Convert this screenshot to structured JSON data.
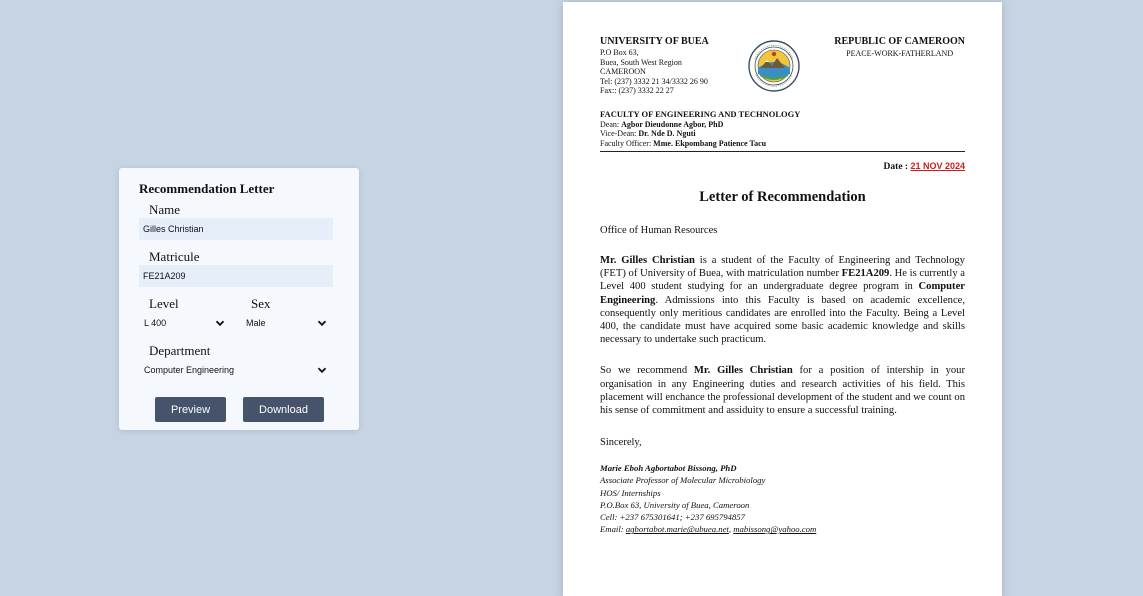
{
  "form": {
    "title": "Recommendation Letter",
    "name_label": "Name",
    "name_value": "Gilles Christian",
    "matricule_label": "Matricule",
    "matricule_value": "FE21A209",
    "level_label": "Level",
    "level_value": "L 400",
    "sex_label": "Sex",
    "sex_value": "Male",
    "department_label": "Department",
    "department_value": "Computer Engineering",
    "preview_label": "Preview",
    "download_label": "Download"
  },
  "letter": {
    "university": "UNIVERSITY OF BUEA",
    "address_lines": [
      "P.O Box 63,",
      "Buea, South West Region",
      "CAMEROON",
      "Tel: (237) 3332 21 34/3332 26 90",
      "Fax:: (237) 3332 22 27"
    ],
    "republic": "REPUBLIC OF CAMEROON",
    "motto": "PEACE-WORK-FATHERLAND",
    "faculty_title": "FACULTY OF ENGINEERING AND TECHNOLOGY",
    "dean_label": "Dean:",
    "dean_name": "Agbor Dieudonne Agbor, PhD",
    "vice_dean_label": "Vice-Dean:",
    "vice_dean_name": "Dr. Nde D. Nguti",
    "officer_label": "Faculty Officer:",
    "officer_name": "Mme. Ekpombang Patience Tacu",
    "date_label": "Date :",
    "date_value": "21 NOV 2024",
    "title": "Letter of Recommendation",
    "recipient": "Office of Human Resources",
    "p1_student": "Mr. Gilles Christian",
    "p1_text_a": " is a student of the Faculty of Engineering and Technology (FET) of University of Buea, with matriculation number ",
    "p1_matricule": "FE21A209",
    "p1_text_b": ". He is currently a Level 400 student studying for an undergraduate degree program in ",
    "p1_department": "Computer Engineering",
    "p1_text_c": ". Admissions into this Faculty is based on academic excellence, consequently only meritious candidates are enrolled into the Faculty. Being a Level 400, the candidate must have acquired some basic academic knowledge and skills necessary to undertake such practicum.",
    "p2_text_a": "So we recommend ",
    "p2_student": "Mr. Gilles Christian",
    "p2_text_b": " for a position of intership in your organisation in any Engineering duties and research activities of his field. This placement will enchance the professional development of the student and we count on his sense of commitment and assiduity to ensure a successful training.",
    "closing": "Sincerely,",
    "signer_name": "Marie Eboh Agbortabot Bissong, PhD",
    "signer_title": "Associate Professor of Molecular Microbiology",
    "signer_role": "HOS/ Internships",
    "signer_address": "P.O.Box 63, University of Buea, Cameroon",
    "signer_cell": "Cell: +237 675301641; +237 695794857",
    "signer_email_label": "Email: ",
    "signer_email_1": "agbortabot.marie@ubuea.net",
    "signer_email_sep": ", ",
    "signer_email_2": "mabissong@yahoo.com"
  },
  "icons": {
    "select_arrow": "chevron-down-icon",
    "seal": "university-seal-icon"
  },
  "colors": {
    "button": "#45536b",
    "date": "#cc1d1d",
    "background": "#c7d4e3"
  }
}
